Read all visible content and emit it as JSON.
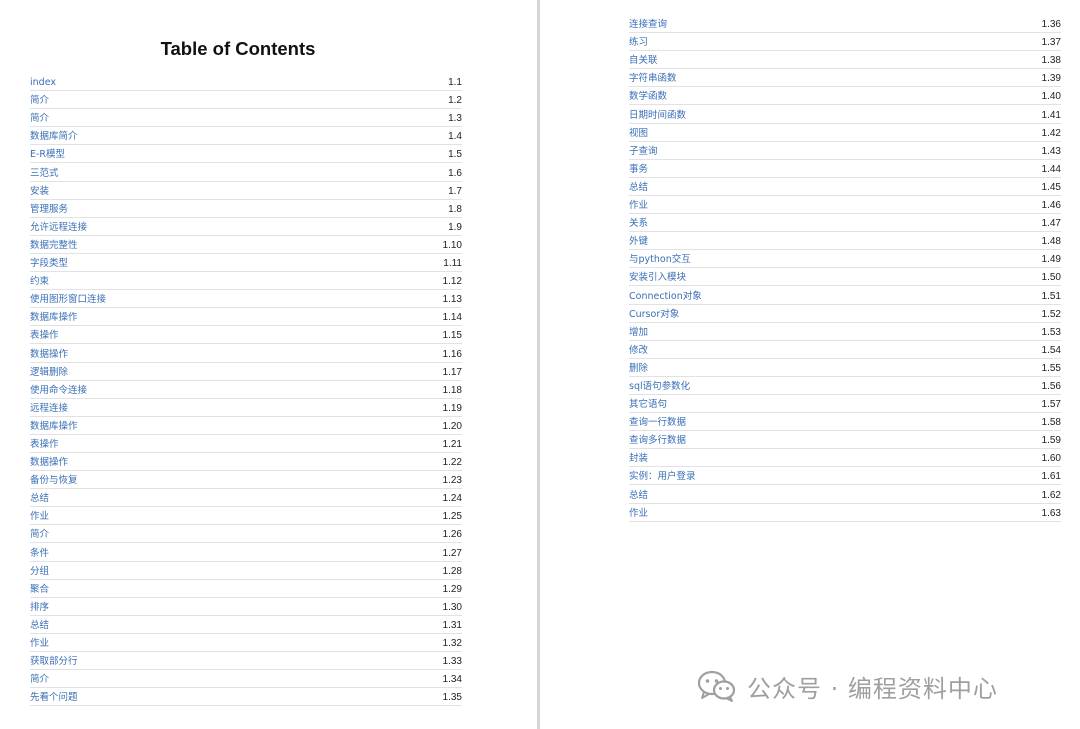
{
  "document": {
    "title": "Table of Contents",
    "left_entries": [
      {
        "label": "index",
        "num": "1.1"
      },
      {
        "label": "简介",
        "num": "1.2"
      },
      {
        "label": "简介",
        "num": "1.3"
      },
      {
        "label": "数据库简介",
        "num": "1.4"
      },
      {
        "label": "E-R模型",
        "num": "1.5"
      },
      {
        "label": "三范式",
        "num": "1.6"
      },
      {
        "label": "安装",
        "num": "1.7"
      },
      {
        "label": "管理服务",
        "num": "1.8"
      },
      {
        "label": "允许远程连接",
        "num": "1.9"
      },
      {
        "label": "数据完整性",
        "num": "1.10"
      },
      {
        "label": "字段类型",
        "num": "1.11"
      },
      {
        "label": "约束",
        "num": "1.12"
      },
      {
        "label": "使用图形窗口连接",
        "num": "1.13"
      },
      {
        "label": "数据库操作",
        "num": "1.14"
      },
      {
        "label": "表操作",
        "num": "1.15"
      },
      {
        "label": "数据操作",
        "num": "1.16"
      },
      {
        "label": "逻辑删除",
        "num": "1.17"
      },
      {
        "label": "使用命令连接",
        "num": "1.18"
      },
      {
        "label": "远程连接",
        "num": "1.19"
      },
      {
        "label": "数据库操作",
        "num": "1.20"
      },
      {
        "label": "表操作",
        "num": "1.21"
      },
      {
        "label": "数据操作",
        "num": "1.22"
      },
      {
        "label": "备份与恢复",
        "num": "1.23"
      },
      {
        "label": "总结",
        "num": "1.24"
      },
      {
        "label": "作业",
        "num": "1.25"
      },
      {
        "label": "简介",
        "num": "1.26"
      },
      {
        "label": "条件",
        "num": "1.27"
      },
      {
        "label": "分组",
        "num": "1.28"
      },
      {
        "label": "聚合",
        "num": "1.29"
      },
      {
        "label": "排序",
        "num": "1.30"
      },
      {
        "label": "总结",
        "num": "1.31"
      },
      {
        "label": "作业",
        "num": "1.32"
      },
      {
        "label": "获取部分行",
        "num": "1.33"
      },
      {
        "label": "简介",
        "num": "1.34"
      },
      {
        "label": "先看个问题",
        "num": "1.35"
      }
    ],
    "right_entries": [
      {
        "label": "连接查询",
        "num": "1.36"
      },
      {
        "label": "练习",
        "num": "1.37"
      },
      {
        "label": "自关联",
        "num": "1.38"
      },
      {
        "label": "字符串函数",
        "num": "1.39"
      },
      {
        "label": "数学函数",
        "num": "1.40"
      },
      {
        "label": "日期时间函数",
        "num": "1.41"
      },
      {
        "label": "视图",
        "num": "1.42"
      },
      {
        "label": "子查询",
        "num": "1.43"
      },
      {
        "label": "事务",
        "num": "1.44"
      },
      {
        "label": "总结",
        "num": "1.45"
      },
      {
        "label": "作业",
        "num": "1.46"
      },
      {
        "label": "关系",
        "num": "1.47"
      },
      {
        "label": "外键",
        "num": "1.48"
      },
      {
        "label": "与python交互",
        "num": "1.49"
      },
      {
        "label": "安装引入模块",
        "num": "1.50"
      },
      {
        "label": "Connection对象",
        "num": "1.51"
      },
      {
        "label": "Cursor对象",
        "num": "1.52"
      },
      {
        "label": "增加",
        "num": "1.53"
      },
      {
        "label": "修改",
        "num": "1.54"
      },
      {
        "label": "删除",
        "num": "1.55"
      },
      {
        "label": "sql语句参数化",
        "num": "1.56"
      },
      {
        "label": "其它语句",
        "num": "1.57"
      },
      {
        "label": "查询一行数据",
        "num": "1.58"
      },
      {
        "label": "查询多行数据",
        "num": "1.59"
      },
      {
        "label": "封装",
        "num": "1.60"
      },
      {
        "label": "实例：用户登录",
        "num": "1.61"
      },
      {
        "label": "总结",
        "num": "1.62"
      },
      {
        "label": "作业",
        "num": "1.63"
      }
    ]
  },
  "watermark": {
    "icon": "wechat-icon",
    "text": "公众号 · 编程资料中心"
  },
  "colors": {
    "link": "#3a6fb5",
    "number": "#222222",
    "rule": "#e2e2e2",
    "divider": "#d6d6d6",
    "watermark": "#8f8f8f"
  }
}
